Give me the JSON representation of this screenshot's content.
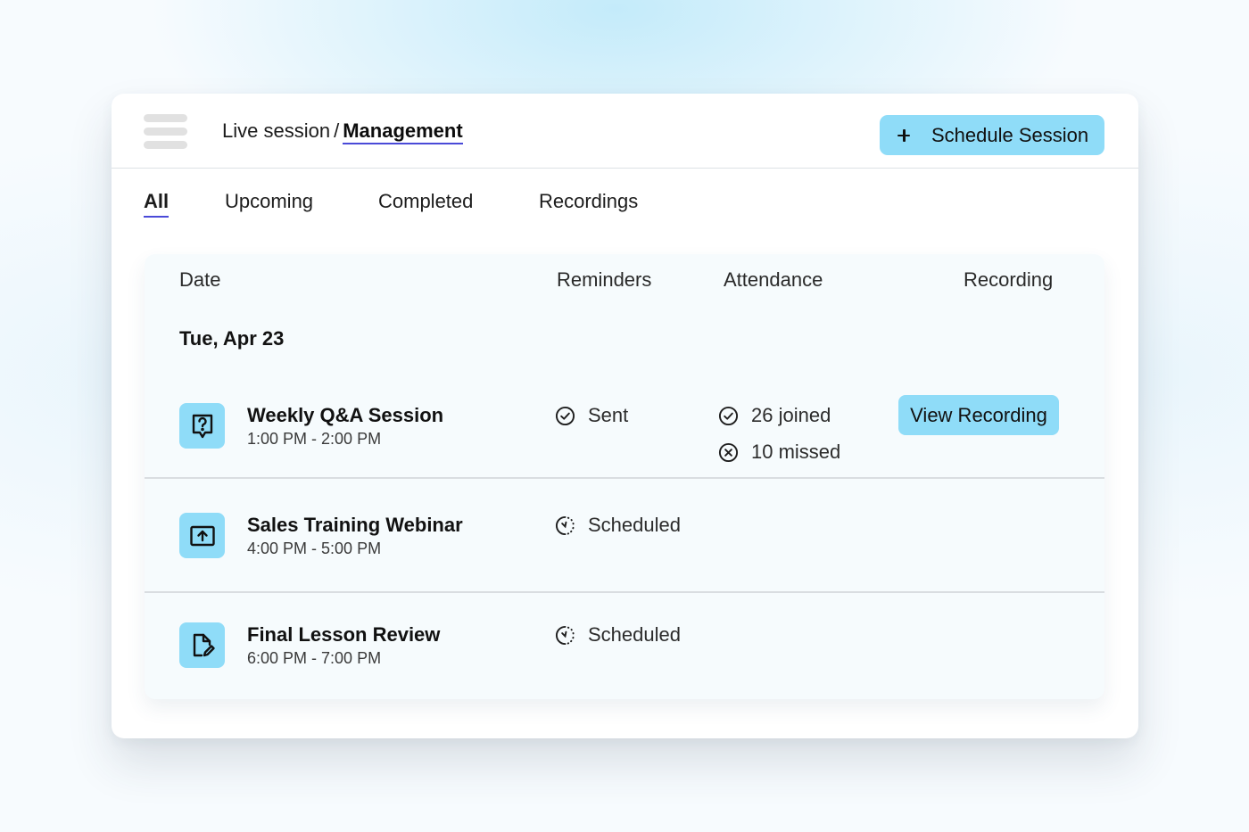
{
  "breadcrumb": {
    "parent": "Live session",
    "separator": "/",
    "current": "Management"
  },
  "toolbar": {
    "schedule_label": "Schedule Session",
    "menu_icon": "hamburger-menu-icon",
    "plus_icon": "plus-icon"
  },
  "tabs": [
    {
      "label": "All",
      "active": true
    },
    {
      "label": "Upcoming",
      "active": false
    },
    {
      "label": "Completed",
      "active": false
    },
    {
      "label": "Recordings",
      "active": false
    }
  ],
  "table": {
    "columns": [
      "Date",
      "Reminders",
      "Attendance",
      "Recording"
    ],
    "date_group": "Tue, Apr 23",
    "rows": [
      {
        "title": "Weekly Q&A Session",
        "time": "1:00 PM - 2:00 PM",
        "icon": "question-chat-icon",
        "reminder": "Sent",
        "reminder_icon": "check-circle-icon",
        "joined": "26 joined",
        "missed": "10 missed",
        "recording_label": "View Recording"
      },
      {
        "title": "Sales Training Webinar",
        "time": "4:00 PM - 5:00 PM",
        "icon": "upload-screen-icon",
        "reminder": "Scheduled",
        "reminder_icon": "clock-dashed-icon"
      },
      {
        "title": "Final Lesson Review",
        "time": "6:00 PM - 7:00 PM",
        "icon": "document-edit-icon",
        "reminder": "Scheduled",
        "reminder_icon": "clock-dashed-icon"
      }
    ]
  },
  "colors": {
    "accent": "#8fdcf8",
    "underline": "#4a4ad8",
    "panel_bg": "#f6fbfd"
  }
}
